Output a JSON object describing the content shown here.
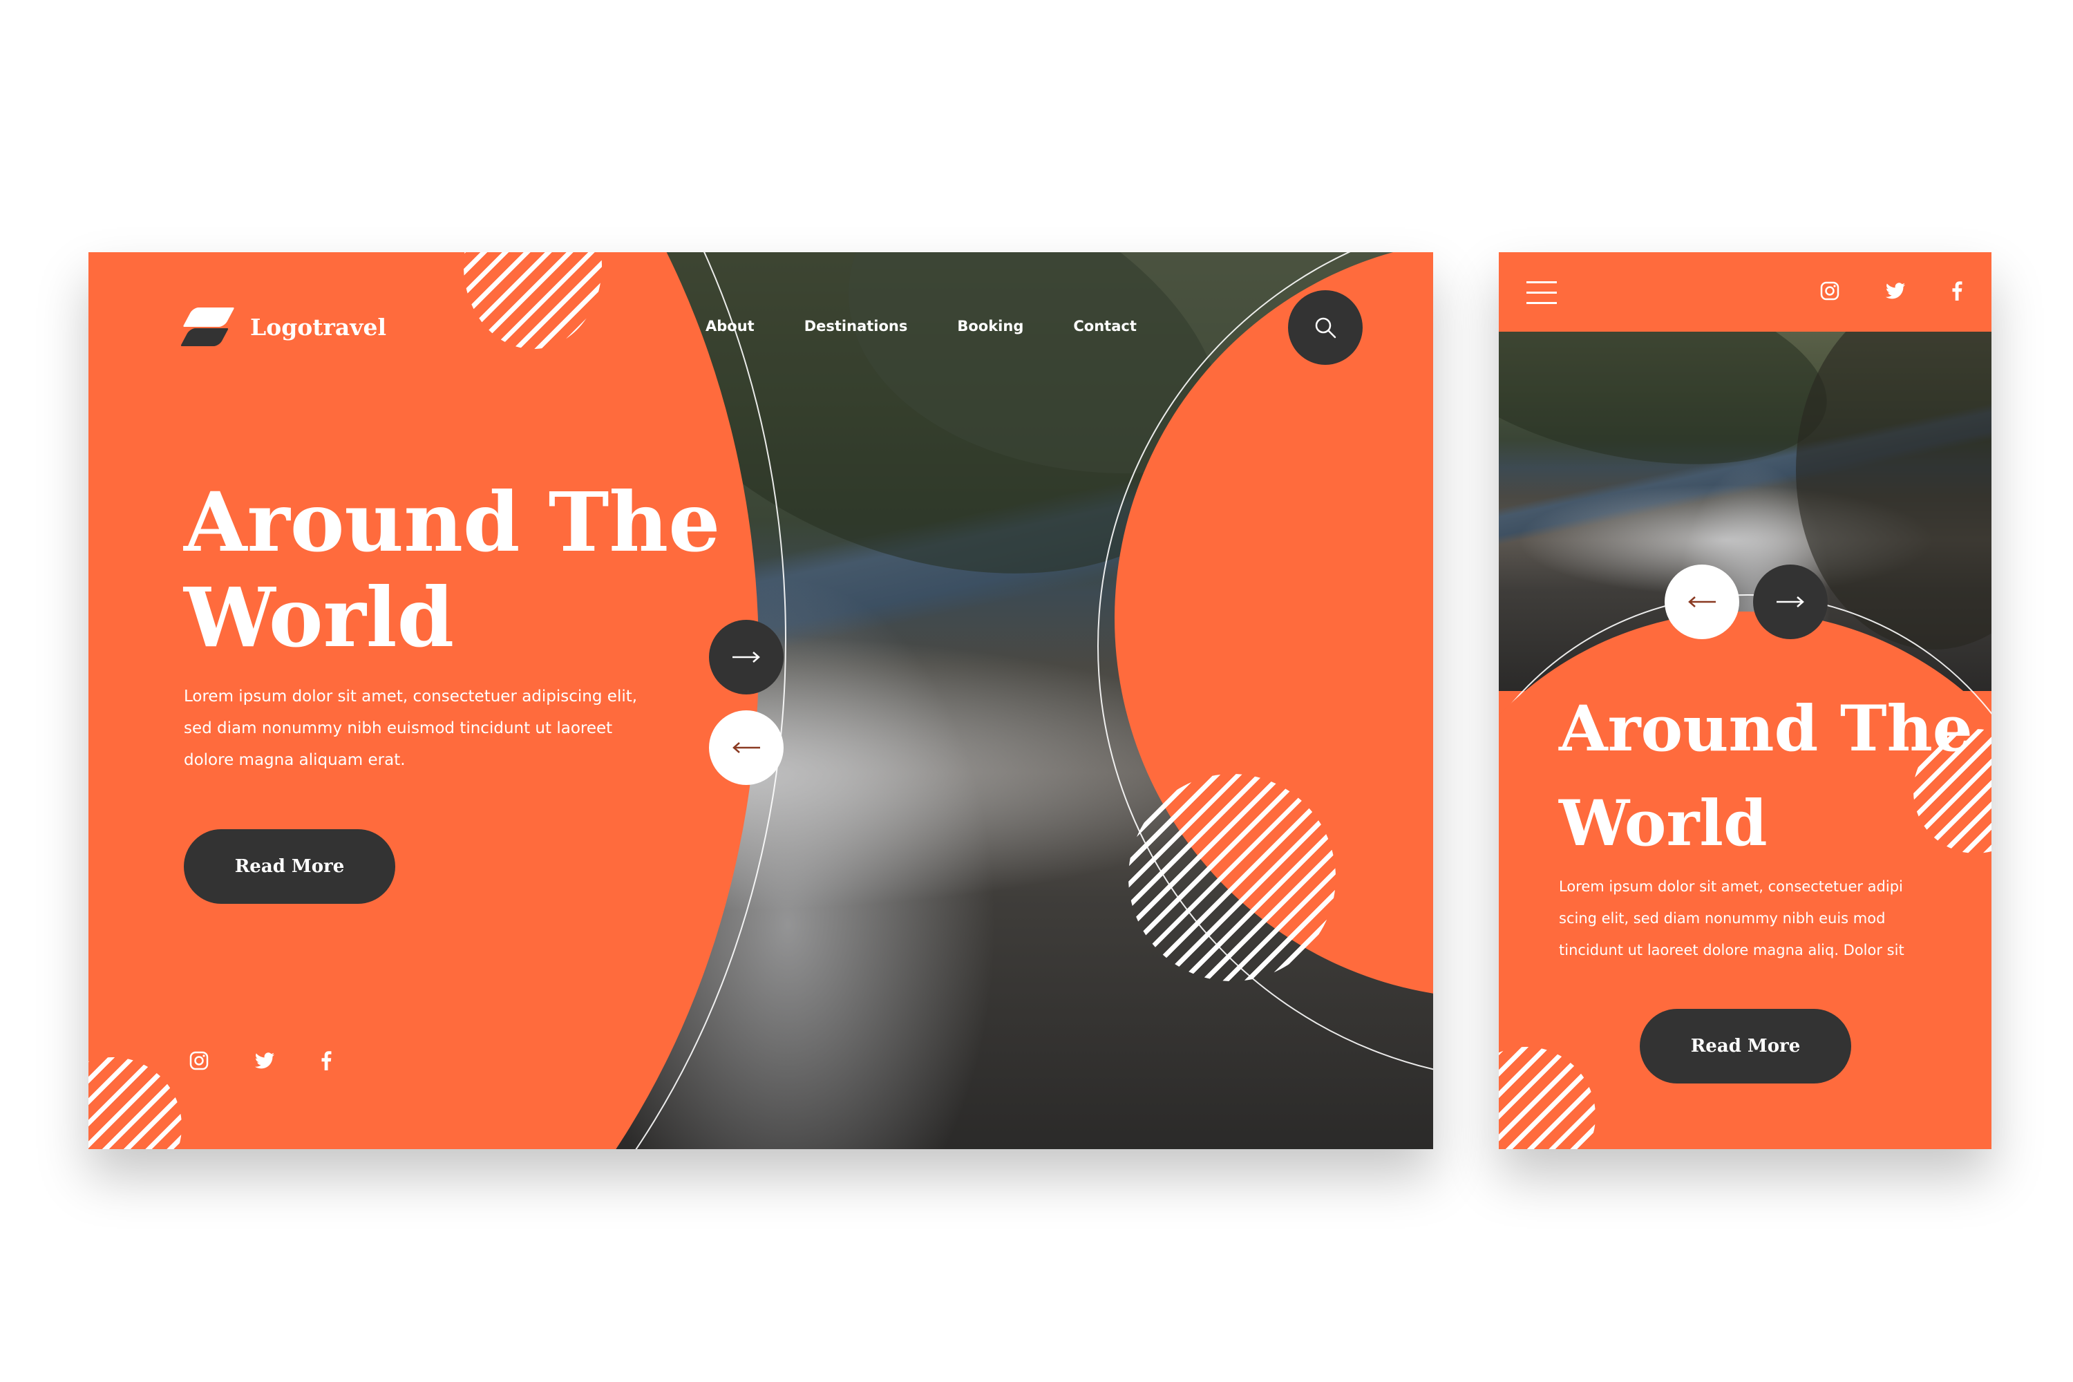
{
  "brand": {
    "name": "Logotravel"
  },
  "nav": {
    "about": "About",
    "destinations": "Destinations",
    "booking": "Booking",
    "contact": "Contact"
  },
  "hero": {
    "title_line1": "Around The",
    "title_line2": "World",
    "desktop_body_1": "Lorem ipsum dolor sit amet, consectetuer adipiscing elit,",
    "desktop_body_2": "sed diam nonummy nibh euismod tincidunt ut laoreet",
    "desktop_body_3": "dolore magna aliquam erat.",
    "mobile_body_1": "Lorem ipsum dolor sit amet, consectetuer adipi",
    "mobile_body_2": "scing elit, sed diam nonummy nibh euis mod",
    "mobile_body_3": "tincidunt ut laoreet dolore magna aliq. Dolor sit",
    "cta": "Read More"
  },
  "colors": {
    "accent": "#ff6b3d",
    "dark": "#333333",
    "white": "#ffffff"
  },
  "icons": [
    "search-icon",
    "arrow-right-icon",
    "arrow-left-icon",
    "instagram-icon",
    "twitter-icon",
    "facebook-icon",
    "hamburger-menu-icon"
  ]
}
